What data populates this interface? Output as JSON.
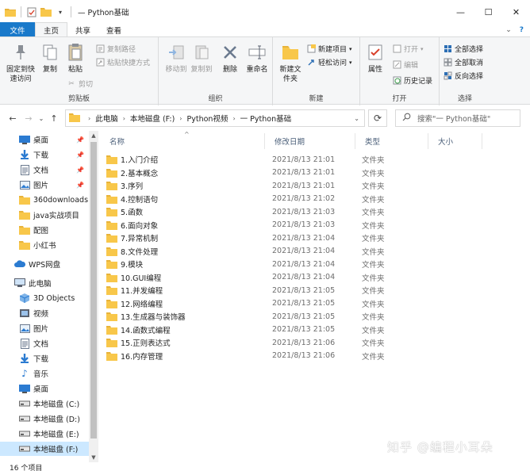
{
  "window": {
    "title": "— Python基础",
    "buttons": {
      "minimize": "—",
      "maximize": "☐",
      "close": "✕"
    }
  },
  "ribbon_tabs": {
    "file": "文件",
    "home": "主页",
    "share": "共享",
    "view": "查看"
  },
  "ribbon": {
    "clipboard": {
      "pin_label": "固定到快速访问",
      "copy_label": "复制",
      "paste_label": "粘贴",
      "copy_path_label": "复制路径",
      "paste_shortcut_label": "粘贴快捷方式",
      "cut_label": "剪切",
      "group_label": "剪贴板"
    },
    "organize": {
      "move_to_label": "移动到",
      "copy_to_label": "复制到",
      "delete_label": "删除",
      "rename_label": "重命名",
      "group_label": "组织"
    },
    "new": {
      "new_folder_label": "新建文件夹",
      "new_item_label": "新建项目",
      "easy_access_label": "轻松访问",
      "group_label": "新建"
    },
    "open": {
      "properties_label": "属性",
      "open_label": "打开",
      "edit_label": "编辑",
      "history_label": "历史记录",
      "group_label": "打开"
    },
    "select": {
      "select_all_label": "全部选择",
      "select_none_label": "全部取消",
      "invert_label": "反向选择",
      "group_label": "选择"
    }
  },
  "address": {
    "crumbs": [
      "此电脑",
      "本地磁盘 (F:)",
      "Python视频",
      "一 Python基础"
    ],
    "search_placeholder": "搜索\"一 Python基础\""
  },
  "nav_pane": {
    "quick_access": [
      {
        "label": "桌面",
        "icon": "desktop-icon",
        "pinned": true
      },
      {
        "label": "下载",
        "icon": "download-icon",
        "pinned": true
      },
      {
        "label": "文档",
        "icon": "document-icon",
        "pinned": true
      },
      {
        "label": "图片",
        "icon": "picture-icon",
        "pinned": true
      },
      {
        "label": "360downloads",
        "icon": "folder-icon",
        "pinned": false
      },
      {
        "label": "java实战项目",
        "icon": "folder-icon",
        "pinned": false
      },
      {
        "label": "配图",
        "icon": "folder-icon",
        "pinned": false
      },
      {
        "label": "小红书",
        "icon": "folder-icon",
        "pinned": false
      }
    ],
    "wps": "WPS网盘",
    "this_pc": "此电脑",
    "pc_items": [
      {
        "label": "3D Objects",
        "icon": "3d-objects-icon"
      },
      {
        "label": "视频",
        "icon": "video-icon"
      },
      {
        "label": "图片",
        "icon": "picture-icon"
      },
      {
        "label": "文档",
        "icon": "document-icon"
      },
      {
        "label": "下载",
        "icon": "download-icon"
      },
      {
        "label": "音乐",
        "icon": "music-icon"
      },
      {
        "label": "桌面",
        "icon": "desktop-icon"
      },
      {
        "label": "本地磁盘 (C:)",
        "icon": "drive-icon"
      },
      {
        "label": "本地磁盘 (D:)",
        "icon": "drive-icon"
      },
      {
        "label": "本地磁盘 (E:)",
        "icon": "drive-icon"
      },
      {
        "label": "本地磁盘 (F:)",
        "icon": "drive-icon"
      }
    ]
  },
  "columns": {
    "name": "名称",
    "date": "修改日期",
    "type": "类型",
    "size": "大小"
  },
  "files": [
    {
      "name": "1.入门介绍",
      "date": "2021/8/13 21:01",
      "type": "文件夹"
    },
    {
      "name": "2.基本概念",
      "date": "2021/8/13 21:01",
      "type": "文件夹"
    },
    {
      "name": "3.序列",
      "date": "2021/8/13 21:01",
      "type": "文件夹"
    },
    {
      "name": "4.控制语句",
      "date": "2021/8/13 21:02",
      "type": "文件夹"
    },
    {
      "name": "5.函数",
      "date": "2021/8/13 21:03",
      "type": "文件夹"
    },
    {
      "name": "6.面向对象",
      "date": "2021/8/13 21:03",
      "type": "文件夹"
    },
    {
      "name": "7.异常机制",
      "date": "2021/8/13 21:04",
      "type": "文件夹"
    },
    {
      "name": "8.文件处理",
      "date": "2021/8/13 21:04",
      "type": "文件夹"
    },
    {
      "name": "9.模块",
      "date": "2021/8/13 21:04",
      "type": "文件夹"
    },
    {
      "name": "10.GUI编程",
      "date": "2021/8/13 21:04",
      "type": "文件夹"
    },
    {
      "name": "11.并发编程",
      "date": "2021/8/13 21:05",
      "type": "文件夹"
    },
    {
      "name": "12.网络编程",
      "date": "2021/8/13 21:05",
      "type": "文件夹"
    },
    {
      "name": "13.生成器与装饰器",
      "date": "2021/8/13 21:05",
      "type": "文件夹"
    },
    {
      "name": "14.函数式编程",
      "date": "2021/8/13 21:05",
      "type": "文件夹"
    },
    {
      "name": "15.正则表达式",
      "date": "2021/8/13 21:06",
      "type": "文件夹"
    },
    {
      "name": "16.内存管理",
      "date": "2021/8/13 21:06",
      "type": "文件夹"
    }
  ],
  "status": {
    "count": "16 个项目"
  },
  "watermark": "知乎 @编程小耳朵",
  "colors": {
    "accent": "#1979ca",
    "folder": "#f8c74a",
    "selected": "#cce8ff"
  }
}
